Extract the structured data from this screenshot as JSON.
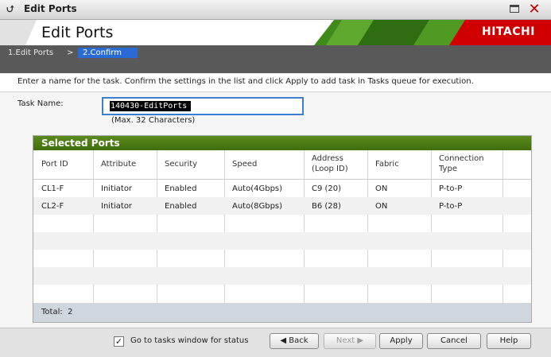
{
  "window": {
    "title": "Edit Ports"
  },
  "banner": {
    "title": "Edit Ports",
    "brand": "HITACHI"
  },
  "wizard": {
    "steps": [
      {
        "label": "1.Edit Ports"
      },
      {
        "label": "2.Confirm"
      }
    ],
    "separator": ">"
  },
  "instructions": "Enter a name for the task. Confirm the settings in the list and click Apply to add task in Tasks queue for execution.",
  "task": {
    "label": "Task Name:",
    "value": "140430-EditPorts",
    "hint": "(Max. 32 Characters)"
  },
  "panel": {
    "title": "Selected Ports",
    "columns": [
      {
        "line1": "Port ID",
        "line2": ""
      },
      {
        "line1": "Attribute",
        "line2": ""
      },
      {
        "line1": "Security",
        "line2": ""
      },
      {
        "line1": "Speed",
        "line2": ""
      },
      {
        "line1": "Address",
        "line2": "(Loop ID)"
      },
      {
        "line1": "Fabric",
        "line2": ""
      },
      {
        "line1": "Connection",
        "line2": "Type"
      }
    ],
    "rows": [
      {
        "port_id": "CL1-F",
        "attribute": "Initiator",
        "security": "Enabled",
        "speed": "Auto(4Gbps)",
        "address": "C9 (20)",
        "fabric": "ON",
        "connection": "P-to-P"
      },
      {
        "port_id": "CL2-F",
        "attribute": "Initiator",
        "security": "Enabled",
        "speed": "Auto(8Gbps)",
        "address": "B6 (28)",
        "fabric": "ON",
        "connection": "P-to-P"
      }
    ],
    "total_label": "Total:",
    "total_value": "2"
  },
  "footer": {
    "checkbox_label": "Go to tasks window for status",
    "checkbox_checked": true,
    "back_label": "Back",
    "next_label": "Next",
    "apply_label": "Apply",
    "cancel_label": "Cancel",
    "help_label": "Help"
  },
  "colors": {
    "accent": "#2a6ad4",
    "panel_header": "#4a7a14",
    "brand_bar": "#3f8a1a",
    "close": "#c00000"
  }
}
